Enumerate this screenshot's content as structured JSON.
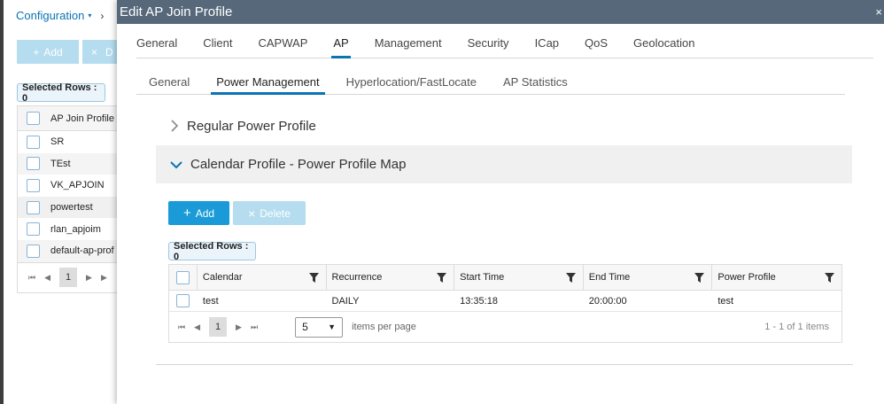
{
  "background": {
    "breadcrumb": "Configuration",
    "add_label": "Add",
    "delete_label": "D",
    "selected_rows": "Selected Rows : 0",
    "column_header": "AP Join Profile",
    "rows": [
      "SR",
      "TEst",
      "VK_APJOIN",
      "powertest",
      "rlan_apjoim",
      "default-ap-prof"
    ],
    "current_page": "1"
  },
  "modal": {
    "title": "Edit AP Join Profile",
    "close": "×",
    "tabs": [
      {
        "label": "General"
      },
      {
        "label": "Client"
      },
      {
        "label": "CAPWAP"
      },
      {
        "label": "AP",
        "active": true
      },
      {
        "label": "Management"
      },
      {
        "label": "Security"
      },
      {
        "label": "ICap"
      },
      {
        "label": "QoS"
      },
      {
        "label": "Geolocation"
      }
    ],
    "subtabs": [
      {
        "label": "General"
      },
      {
        "label": "Power Management",
        "active": true
      },
      {
        "label": "Hyperlocation/FastLocate"
      },
      {
        "label": "AP Statistics"
      }
    ],
    "accordion": {
      "regular": "Regular Power Profile",
      "calendar": "Calendar Profile - Power Profile Map"
    },
    "buttons": {
      "add": "Add",
      "delete": "Delete"
    },
    "selected_rows": "Selected Rows : 0",
    "table": {
      "columns": [
        "Calendar",
        "Recurrence",
        "Start Time",
        "End Time",
        "Power Profile"
      ],
      "rows": [
        [
          "test",
          "DAILY",
          "13:35:18",
          "20:00:00",
          "test"
        ]
      ]
    },
    "pager": {
      "current_page": "1",
      "page_size": "5",
      "items_per_page": "items per page",
      "count": "1 - 1 of 1 items"
    }
  },
  "colors": {
    "accent": "#0a74b5",
    "header_bg": "#56687a",
    "primary_button": "#1a9bd7",
    "disabled_button": "#b5ddef"
  }
}
